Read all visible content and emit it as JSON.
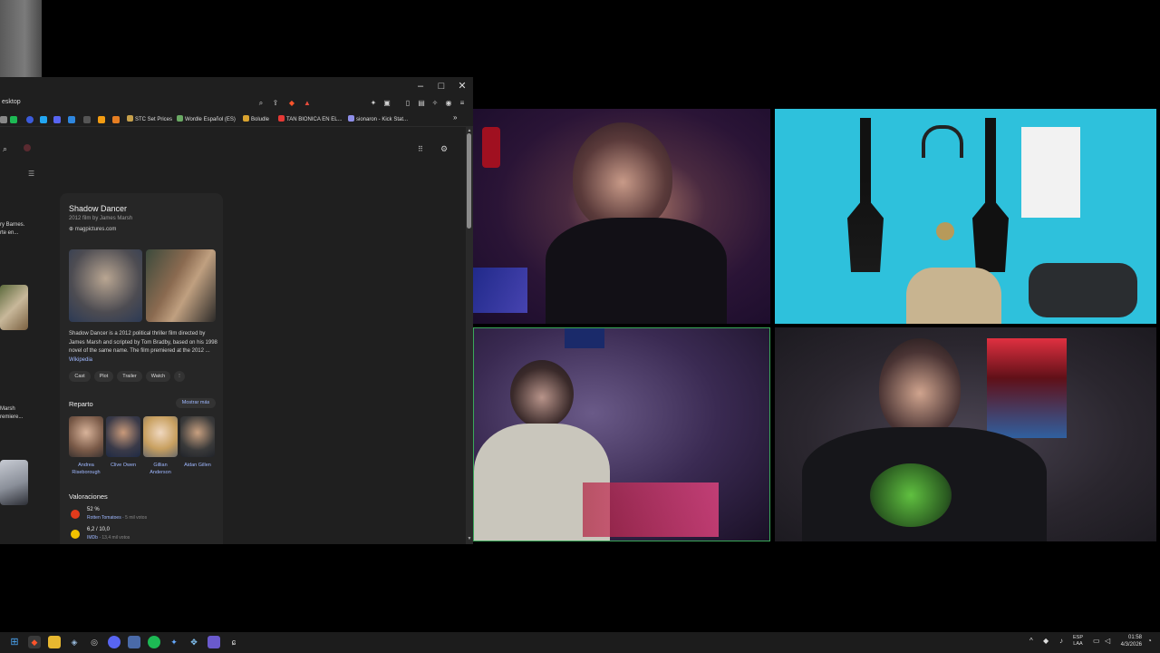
{
  "browser": {
    "address": "esktop",
    "bookmarks": [
      {
        "label": "STC Set Prices",
        "color": "#c6a04b"
      },
      {
        "label": "Wordle Español (ES)",
        "color": "#6aaa64"
      },
      {
        "label": "Boludle",
        "color": "#d9a32f"
      },
      {
        "label": "TAN BIONICA EN EL...",
        "color": "#e53935"
      },
      {
        "label": "sionaron - Kick Stat...",
        "color": "#8e8ee8"
      }
    ],
    "more_bookmarks": "»",
    "window_buttons": {
      "minimize": "–",
      "maximize": "□",
      "close": "✕"
    }
  },
  "results": {
    "snippet1": [
      "ry Barnes.",
      "rte en..."
    ],
    "snippet2": [
      "Marsh",
      "remiere..."
    ]
  },
  "knowledge_panel": {
    "title": "Shadow Dancer",
    "subtitle": "2012 film by James Marsh",
    "site": "magpictures.com",
    "description": "Shadow Dancer is a 2012 political thriller film directed by James Marsh and scripted by Tom Bradby, based on his 1998 novel of the same name. The film premiered at the 2012 ...",
    "description_link": "Wikipedia",
    "chips": [
      "Cast",
      "Plot",
      "Trailer",
      "Watch",
      "⋮"
    ],
    "cast_heading": "Reparto",
    "show_more": "Mostrar más",
    "cast": [
      {
        "name": "Andrea Riseborough"
      },
      {
        "name": "Clive Owen"
      },
      {
        "name": "Gillian Anderson"
      },
      {
        "name": "Aidan Gillen"
      }
    ],
    "ratings_heading": "Valoraciones",
    "ratings": [
      {
        "value": "52 %",
        "source": "Rotten Tomatoes",
        "votes": "5 mil votos",
        "color": "#e23b1c"
      },
      {
        "value": "6,2 / 10,0",
        "source": "IMDb",
        "votes": "13,4 mil votos",
        "color": "#f2c200"
      }
    ]
  },
  "taskbar": {
    "language": [
      "ESP",
      "LAA"
    ],
    "time": "01:58",
    "date": "4/3/2026"
  }
}
